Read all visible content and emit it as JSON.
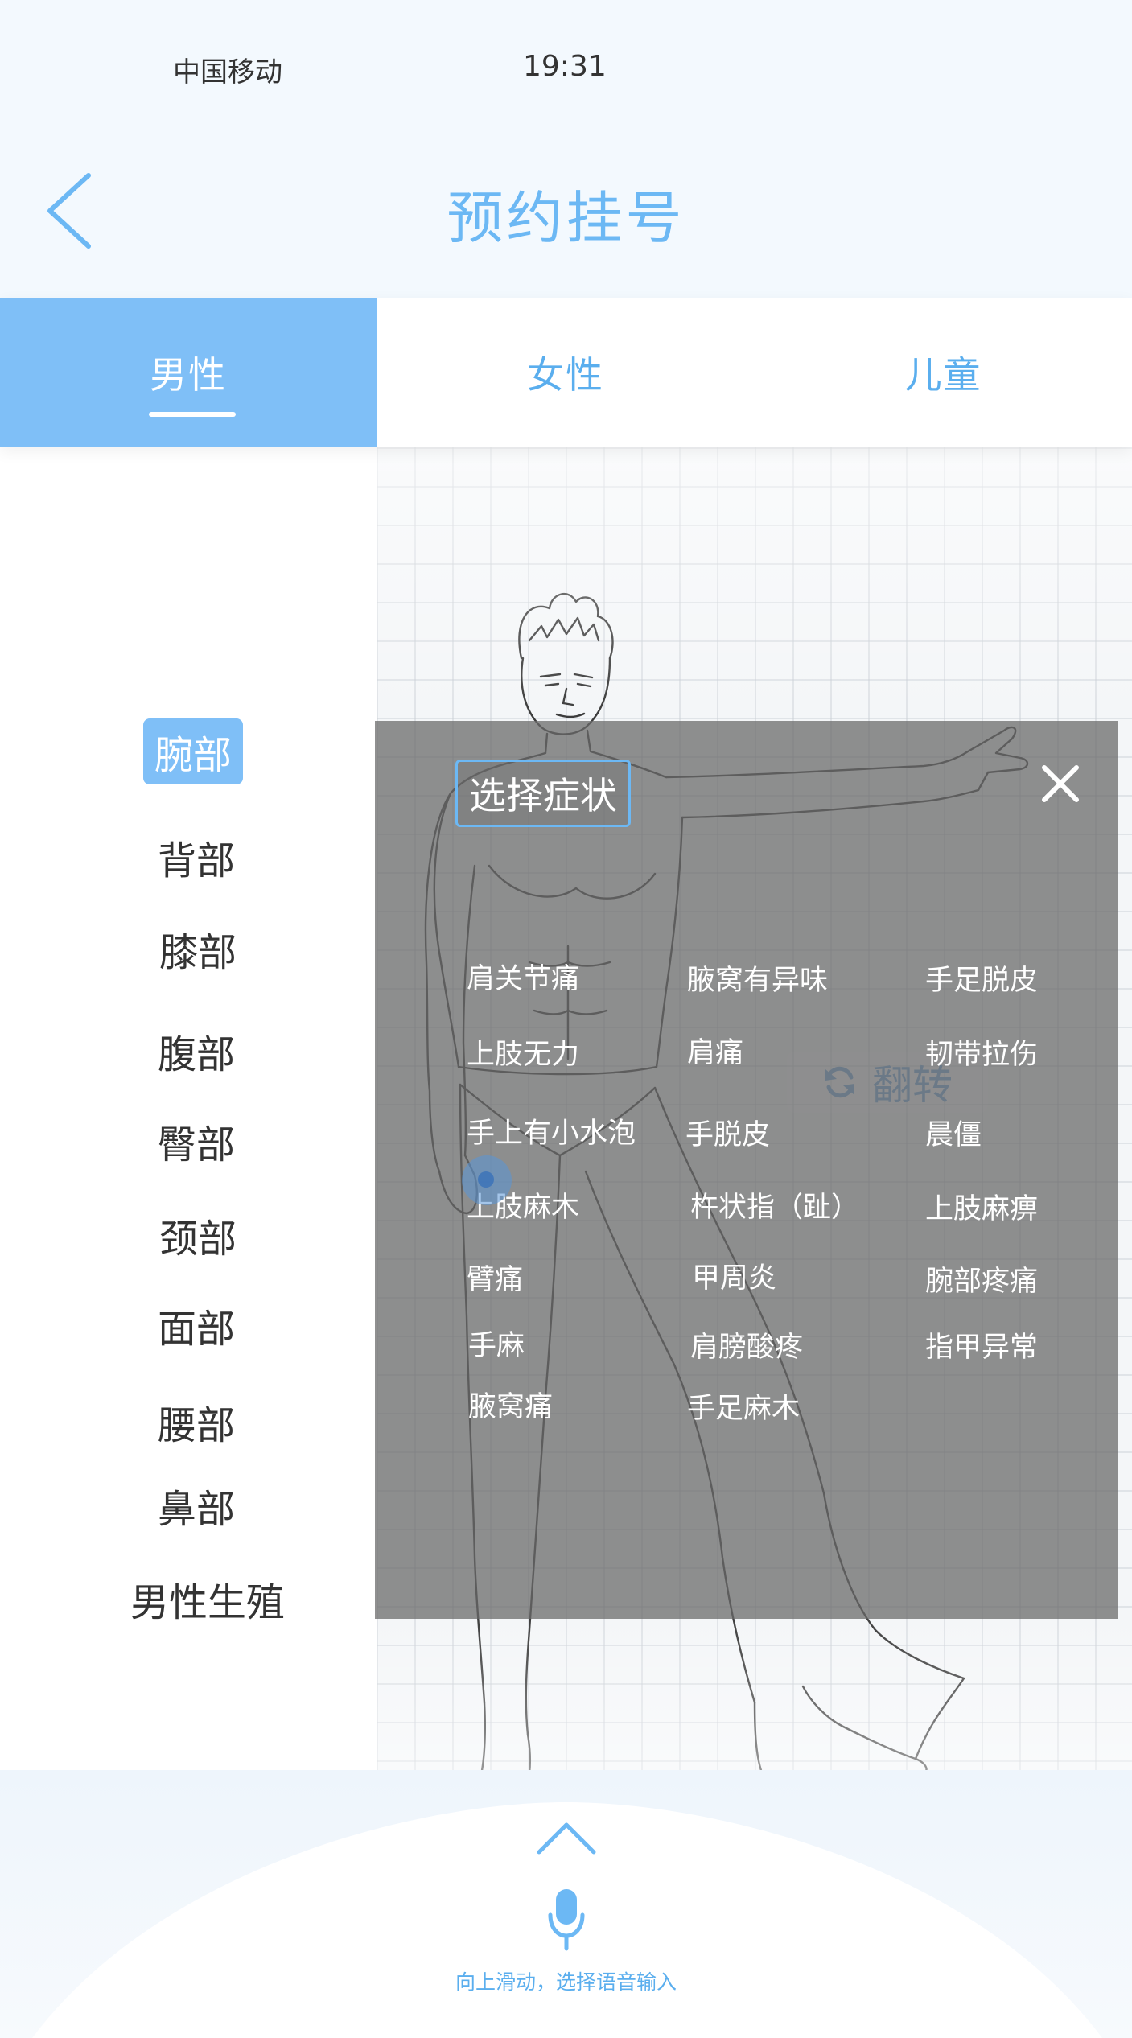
{
  "status_bar": {
    "carrier": "中国移动",
    "time": "19:31"
  },
  "header": {
    "title": "预约挂号",
    "back_icon": "chevron-left-icon"
  },
  "colors": {
    "accent": "#7fbff7",
    "title": "#6cb8f4",
    "modal_overlay": "#696969"
  },
  "tabs": [
    {
      "label": "男性",
      "active": true
    },
    {
      "label": "女性",
      "active": false
    },
    {
      "label": "儿童",
      "active": false
    }
  ],
  "body_parts": [
    {
      "label": "腕部",
      "active": true
    },
    {
      "label": "背部"
    },
    {
      "label": "膝部"
    },
    {
      "label": "腹部"
    },
    {
      "label": "臀部"
    },
    {
      "label": "颈部"
    },
    {
      "label": "面部"
    },
    {
      "label": "腰部"
    },
    {
      "label": "鼻部"
    },
    {
      "label": "男性生殖"
    }
  ],
  "flip_button": {
    "label": "翻转",
    "icon": "refresh-icon"
  },
  "symptom_modal": {
    "title": "选择症状",
    "close_icon": "close-icon",
    "symptoms": [
      "肩关节痛",
      "腋窝有异味",
      "手足脱皮",
      "上肢无力",
      "肩痛",
      "韧带拉伤",
      "手上有小水泡",
      "手脱皮",
      "晨僵",
      "上肢麻木",
      "杵状指（趾）",
      "上肢麻痹",
      "臂痛",
      "甲周炎",
      "腕部疼痛",
      "手麻",
      "肩膀酸疼",
      "指甲异常",
      "腋窝痛",
      "手足麻木"
    ]
  },
  "voice": {
    "hint": "向上滑动，选择语音输入",
    "mic_icon": "microphone-icon",
    "swipe_icon": "chevron-up-icon"
  }
}
